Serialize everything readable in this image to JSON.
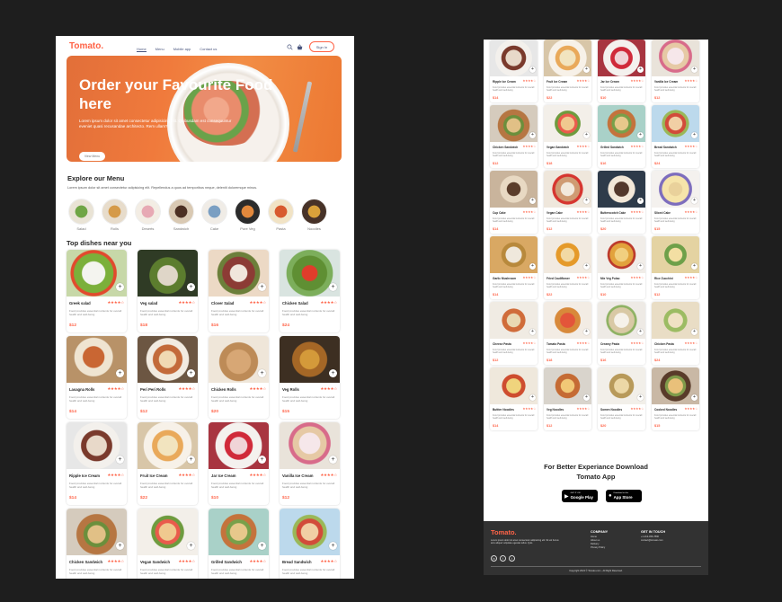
{
  "header": {
    "logo": "Tomato.",
    "nav": [
      "Home",
      "Menu",
      "Mobile app",
      "Contact us"
    ],
    "signin": "Sign In",
    "icons": [
      "search-icon",
      "basket-icon"
    ]
  },
  "hero": {
    "title": "Order your Favourite Food here",
    "text": "Lorem ipsum dolor sit amet consectetur adipisicing elit. Quibusdam est consequuntur eveniet quasi recusandae architecto. Rem ullam?",
    "button": "View Menu"
  },
  "explore": {
    "title": "Explore our Menu",
    "desc": "Lorem ipsum dolor sit amet consectetur adipisicing elit. Repellendus a quos ad temporibus neque, deleniti doloremque minus.",
    "categories": [
      "Salad",
      "Rolls",
      "Deserts",
      "Sandwich",
      "Cake",
      "Pure Veg",
      "Pasta",
      "Noodles"
    ]
  },
  "top_dishes": {
    "title": "Top dishes near you",
    "desc_text": "Food provides essential nutrients for overall health and well-being",
    "rating": "★★★★☆",
    "items": [
      {
        "name": "Greek salad",
        "price": "$12"
      },
      {
        "name": "Veg salad",
        "price": "$18"
      },
      {
        "name": "Clover Salad",
        "price": "$16"
      },
      {
        "name": "Chicken Salad",
        "price": "$24"
      },
      {
        "name": "Lasagna Rolls",
        "price": "$14"
      },
      {
        "name": "Peri Peri Rolls",
        "price": "$12"
      },
      {
        "name": "Chicken Rolls",
        "price": "$20"
      },
      {
        "name": "Veg Rolls",
        "price": "$15"
      },
      {
        "name": "Ripple Ice Cream",
        "price": "$14"
      },
      {
        "name": "Fruit Ice Cream",
        "price": "$22"
      },
      {
        "name": "Jar Ice Cream",
        "price": "$10"
      },
      {
        "name": "Vanilla Ice Cream",
        "price": "$12"
      },
      {
        "name": "Chicken Sandwich",
        "price": "$12"
      },
      {
        "name": "Vegan Sandwich",
        "price": "$18"
      },
      {
        "name": "Grilled Sandwich",
        "price": "$16"
      },
      {
        "name": "Bread Sandwich",
        "price": "$24"
      }
    ]
  },
  "right_dishes": {
    "items": [
      {
        "name": "Ripple Ice Cream",
        "price": "$14"
      },
      {
        "name": "Fruit Ice Cream",
        "price": "$22"
      },
      {
        "name": "Jar Ice Cream",
        "price": "$10"
      },
      {
        "name": "Vanilla Ice Cream",
        "price": "$12"
      },
      {
        "name": "Chicken Sandwich",
        "price": "$12"
      },
      {
        "name": "Vegan Sandwich",
        "price": "$18"
      },
      {
        "name": "Grilled Sandwich",
        "price": "$16"
      },
      {
        "name": "Bread Sandwich",
        "price": "$24"
      },
      {
        "name": "Cup Cake",
        "price": "$14"
      },
      {
        "name": "Vegan Cake",
        "price": "$12"
      },
      {
        "name": "Butterscotch Cake",
        "price": "$20"
      },
      {
        "name": "Sliced Cake",
        "price": "$15"
      },
      {
        "name": "Garlic Mushroom",
        "price": "$14"
      },
      {
        "name": "Fried Cauliflower",
        "price": "$22"
      },
      {
        "name": "Mix Veg Pulao",
        "price": "$10"
      },
      {
        "name": "Rice Zucchini",
        "price": "$12"
      },
      {
        "name": "Cheese Pasta",
        "price": "$12"
      },
      {
        "name": "Tomato Pasta",
        "price": "$18"
      },
      {
        "name": "Creamy Pasta",
        "price": "$16"
      },
      {
        "name": "Chicken Pasta",
        "price": "$24"
      },
      {
        "name": "Buttter Noodles",
        "price": "$14"
      },
      {
        "name": "Veg Noodles",
        "price": "$12"
      },
      {
        "name": "Somen Noodles",
        "price": "$20"
      },
      {
        "name": "Cooked Noodles",
        "price": "$15"
      }
    ]
  },
  "app_download": {
    "line1": "For Better Experiance Download",
    "line2": "Tomato App",
    "google_small": "GET IT ON",
    "google_big": "Google Play",
    "apple_small": "Download on the",
    "apple_big": "App Store"
  },
  "footer": {
    "logo": "Tomato.",
    "desc": "Lorem ipsum dolor sit amet consectetur adipisicing elit. Sit vel fuctus arcu aliquet vulputate egestas tellus. Quis.",
    "social": [
      "in",
      "f",
      "t"
    ],
    "company_title": "COMPANY",
    "company_items": [
      "Home",
      "About us",
      "Delivery",
      "Privacy Policy"
    ],
    "contact_title": "GET IN TOUCH",
    "contact_items": [
      "+1-212-456-7890",
      "contact@tomato.com"
    ],
    "copyright": "Copyright 2024 © Tomato.com - All Right Reserved."
  },
  "colors": {
    "accent": "#ff6347",
    "text": "#262626",
    "footer_bg": "#323232",
    "page_bg": "#1e1e1e"
  }
}
